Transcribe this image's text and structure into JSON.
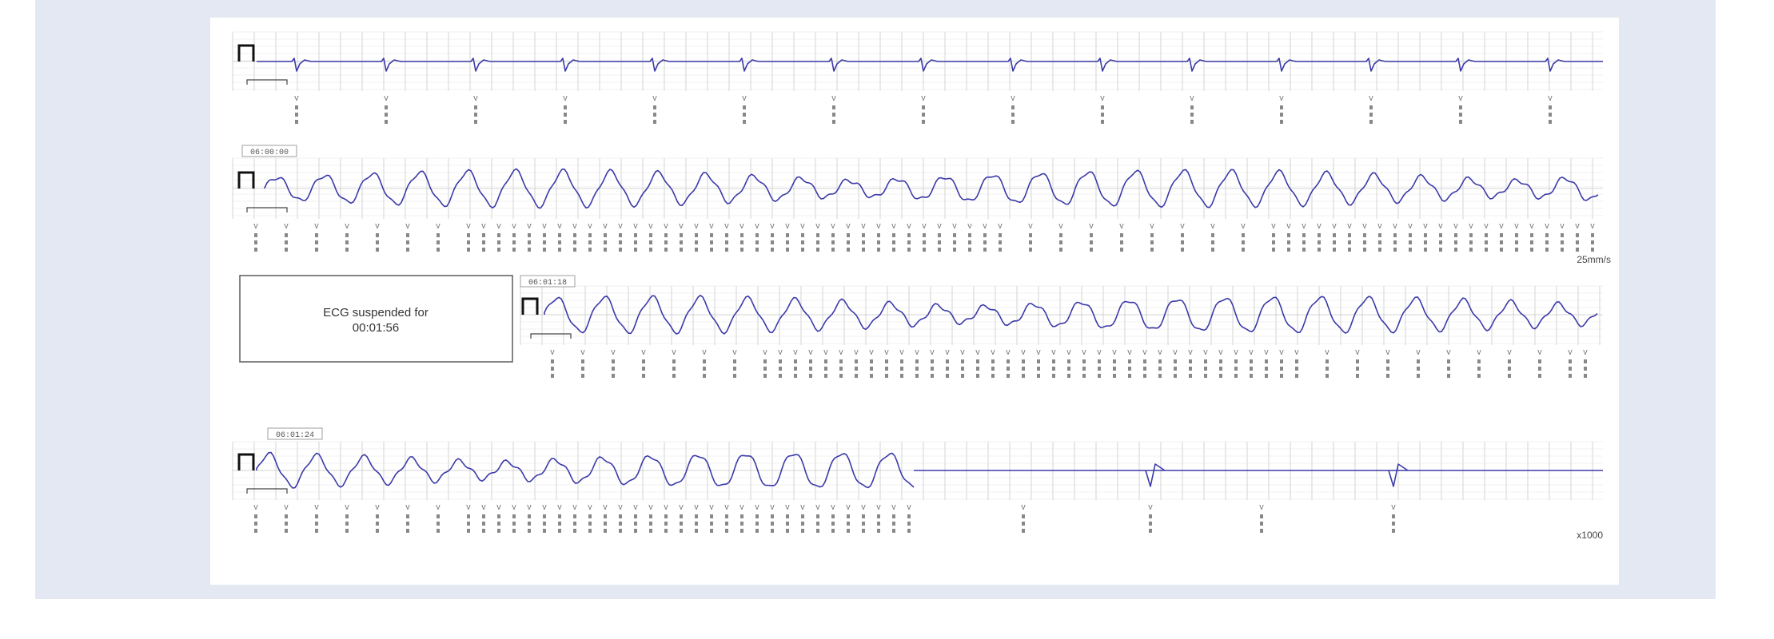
{
  "colors": {
    "background": "#e4e8f2",
    "paper": "#ffffff",
    "trace": "#3b3aa8",
    "grid_major": "#c8c8c8",
    "grid_minor": "#e6e6e6"
  },
  "strips": [
    {
      "id": "strip-1",
      "rhythm": "paced-with-pvc",
      "timestamp": "",
      "calibration_pulse": true
    },
    {
      "id": "strip-2",
      "rhythm": "polymorphic-vt",
      "timestamp": "06:00:00",
      "calibration_pulse": true,
      "speed_label": "25mm/s"
    },
    {
      "id": "strip-3",
      "rhythm": "polymorphic-vt",
      "timestamp": "06:01:18",
      "calibration_pulse": true
    },
    {
      "id": "strip-4",
      "rhythm": "vt-to-paced",
      "timestamp": "06:01:24",
      "calibration_pulse": true,
      "end_label": "x1000"
    }
  ],
  "suspension_box": {
    "line1": "ECG suspended for",
    "line2": "00:01:56"
  }
}
